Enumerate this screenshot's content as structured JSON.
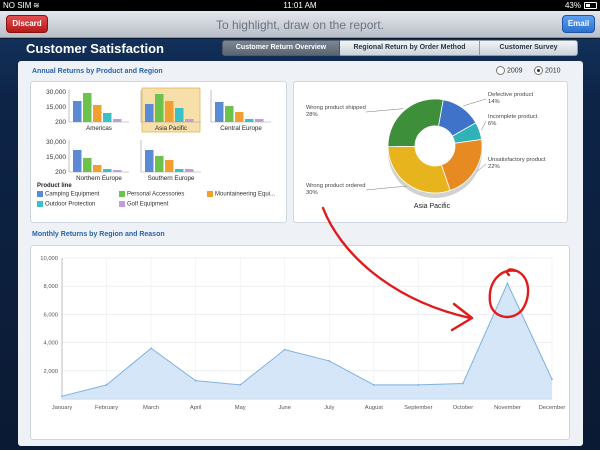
{
  "status": {
    "carrier": "NO SIM",
    "wifi": "≋",
    "time": "11:01 AM",
    "battery": "43%"
  },
  "toolbar": {
    "discard_label": "Discard",
    "message": "To highlight, draw on the report.",
    "email_label": "Email"
  },
  "app": {
    "title": "Customer Satisfaction",
    "tabs": [
      {
        "label": "Customer Return Overview",
        "active": true
      },
      {
        "label": "Regional Return by Order Method",
        "active": false
      },
      {
        "label": "Customer Survey",
        "active": false
      }
    ]
  },
  "report": {
    "section1_title": "Annual Returns by Product and Region",
    "section2_title": "Monthly Returns by Region and Reason",
    "years": [
      {
        "label": "2009",
        "selected": false
      },
      {
        "label": "2010",
        "selected": true
      }
    ],
    "legend_title": "Product line",
    "legend": [
      {
        "label": "Camping Equipment",
        "color": "#5b8bd4"
      },
      {
        "label": "Personal Accessories",
        "color": "#6cc24a"
      },
      {
        "label": "Mountaineering Equi...",
        "color": "#f0a030"
      },
      {
        "label": "Outdoor Protection",
        "color": "#3cc0c8"
      },
      {
        "label": "Golf Equipment",
        "color": "#c49ae0"
      }
    ]
  },
  "chart_data": [
    {
      "type": "bar",
      "title": "Annual Returns by Product and Region",
      "ytick_labels": [
        "30,000",
        "15,000",
        "200"
      ],
      "ylim": [
        0,
        30000
      ],
      "series_names": [
        "Camping Equipment",
        "Personal Accessories",
        "Mountaineering Equi...",
        "Outdoor Protection",
        "Golf Equipment"
      ],
      "regions": [
        {
          "name": "Americas",
          "highlighted": false,
          "values": [
            21000,
            29000,
            17000,
            9000,
            3000
          ]
        },
        {
          "name": "Asia Pacific",
          "highlighted": true,
          "values": [
            18000,
            28000,
            21000,
            14000,
            3000
          ]
        },
        {
          "name": "Central Europe",
          "highlighted": false,
          "values": [
            20000,
            16000,
            10000,
            3000,
            3000
          ]
        },
        {
          "name": "Northern Europe",
          "highlighted": false,
          "values": [
            22000,
            14000,
            7000,
            3000,
            2000
          ]
        },
        {
          "name": "Southern Europe",
          "highlighted": false,
          "values": [
            22000,
            16000,
            12000,
            3000,
            3000
          ]
        }
      ]
    },
    {
      "type": "pie",
      "title": "Asia Pacific",
      "style": "donut",
      "slices": [
        {
          "label": "Defective product",
          "pct": "14%",
          "value": 14,
          "color": "#3f73c9"
        },
        {
          "label": "Incomplete product",
          "pct": "6%",
          "value": 6,
          "color": "#2fb3b8"
        },
        {
          "label": "Unsatisfactory product",
          "pct": "22%",
          "value": 22,
          "color": "#e88a22"
        },
        {
          "label": "Wrong product ordered",
          "pct": "30%",
          "value": 30,
          "color": "#e8b41e"
        },
        {
          "label": "Wrong product shipped",
          "pct": "28%",
          "value": 28,
          "color": "#3e8f3a"
        }
      ]
    },
    {
      "type": "area",
      "title": "Monthly Returns by Region and Reason",
      "categories": [
        "January",
        "February",
        "March",
        "April",
        "May",
        "June",
        "July",
        "August",
        "September",
        "October",
        "November",
        "December"
      ],
      "values": [
        200,
        1000,
        3600,
        1300,
        1000,
        3500,
        2700,
        1000,
        1000,
        1100,
        8200,
        1400
      ],
      "ylim": [
        0,
        10000
      ],
      "yticks": [
        2000,
        4000,
        6000,
        8000,
        10000
      ],
      "ytick_labels": [
        "2,000",
        "4,000",
        "6,000",
        "8,000",
        "10,000"
      ],
      "grid": true
    }
  ]
}
